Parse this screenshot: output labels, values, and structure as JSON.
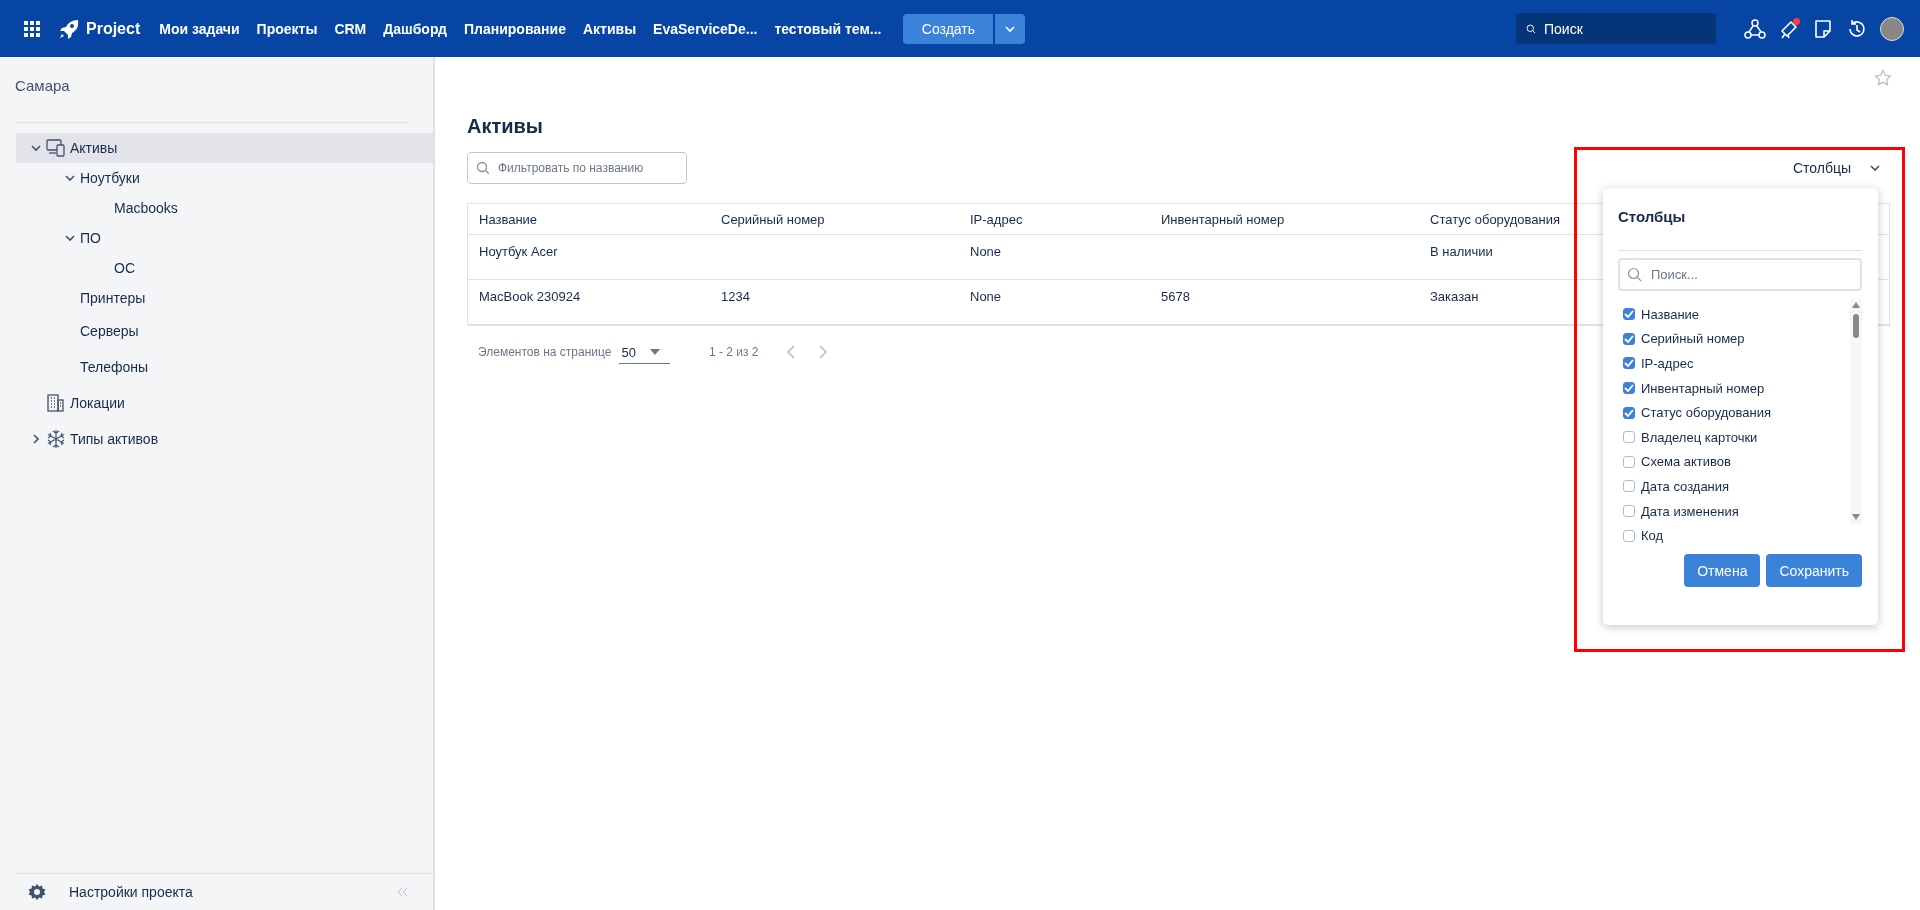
{
  "top_bar": {
    "product": "Project",
    "nav": [
      {
        "label": "Мои задачи"
      },
      {
        "label": "Проекты"
      },
      {
        "label": "CRM"
      },
      {
        "label": "Дашборд"
      },
      {
        "label": "Планирование"
      },
      {
        "label": "Активы"
      },
      {
        "label": "EvaServiceDe..."
      },
      {
        "label": "тестовый тем..."
      }
    ],
    "create_button": "Создать",
    "search": {
      "placeholder": "Поиск"
    },
    "notification_dot": true
  },
  "sidebar": {
    "project": "Самара",
    "tree": [
      {
        "label": "Активы",
        "expanded": true,
        "selected": true,
        "children": [
          {
            "label": "Ноутбуки",
            "expanded": true,
            "selected": false,
            "children": [
              {
                "label": "Macbooks",
                "selected": false
              }
            ]
          },
          {
            "label": "ПО",
            "expanded": true,
            "selected": false,
            "children": [
              {
                "label": "ОС",
                "selected": false
              }
            ]
          },
          {
            "label": "Принтеры",
            "selected": false
          },
          {
            "label": "Серверы",
            "selected": false
          },
          {
            "label": "Телефоны",
            "selected": false
          }
        ]
      },
      {
        "label": "Локации",
        "selected": false
      },
      {
        "label": "Типы активов",
        "expanded": false,
        "selected": false
      }
    ],
    "settings": "Настройки проекта"
  },
  "page": {
    "title": "Активы",
    "filter": {
      "placeholder": "Фильтровать по названию"
    },
    "columns_button": "Столбцы",
    "table": {
      "columns": [
        "Название",
        "Серийный номер",
        "IP-адрес",
        "Инвентарный номер",
        "Статус оборудования"
      ],
      "rows": [
        [
          "Ноутбук Acer",
          "",
          "None",
          "",
          "В наличии"
        ],
        [
          "MacBook 230924",
          "1234",
          "None",
          "5678",
          "Заказан"
        ]
      ]
    },
    "pagination": {
      "label": "Элементов на странице",
      "page_size": "50",
      "range": "1 - 2 из 2"
    }
  },
  "columns_popup": {
    "title": "Столбцы",
    "search": {
      "placeholder": "Поиск..."
    },
    "items": [
      {
        "label": "Название",
        "checked": true
      },
      {
        "label": "Серийный номер",
        "checked": true
      },
      {
        "label": "IP-адрес",
        "checked": true
      },
      {
        "label": "Инвентарный номер",
        "checked": true
      },
      {
        "label": "Статус оборудования",
        "checked": true
      },
      {
        "label": "Владелец карточки",
        "checked": false
      },
      {
        "label": "Схема активов",
        "checked": false
      },
      {
        "label": "Дата создания",
        "checked": false
      },
      {
        "label": "Дата изменения",
        "checked": false
      },
      {
        "label": "Код",
        "checked": false
      }
    ],
    "buttons": [
      "Отмена",
      "Сохранить"
    ]
  },
  "annotation": {
    "kind": "frame",
    "color": "#ff0000"
  }
}
